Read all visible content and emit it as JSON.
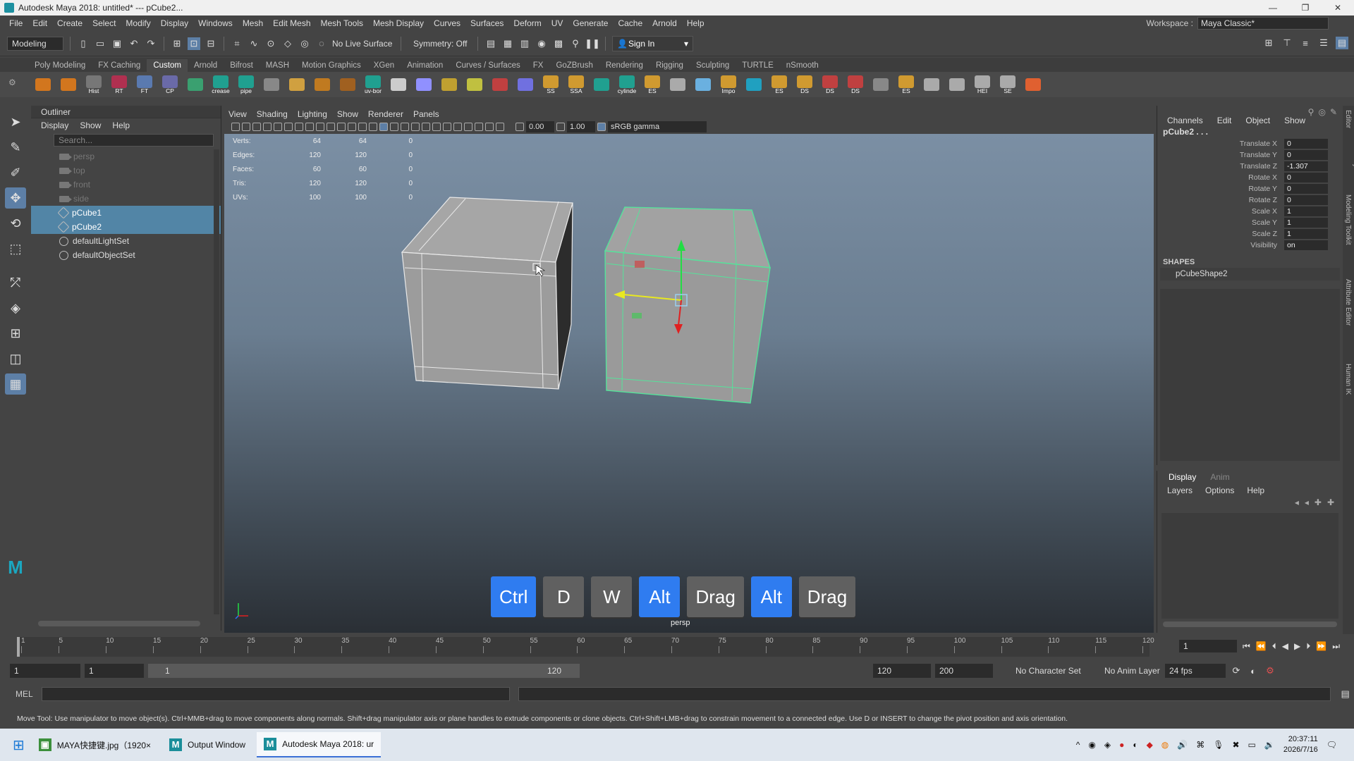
{
  "window": {
    "title": "Autodesk Maya 2018: untitled*   ---   pCube2...",
    "minimize": "—",
    "maximize": "❐",
    "close": "✕"
  },
  "menubar": {
    "items": [
      "File",
      "Edit",
      "Create",
      "Select",
      "Modify",
      "Display",
      "Windows",
      "Mesh",
      "Edit Mesh",
      "Mesh Tools",
      "Mesh Display",
      "Curves",
      "Surfaces",
      "Deform",
      "UV",
      "Generate",
      "Cache",
      "Arnold",
      "Help"
    ],
    "workspace_label": "Workspace :",
    "workspace_value": "Maya Classic*"
  },
  "statusline": {
    "mode": "Modeling",
    "live_surface": "No Live Surface",
    "symmetry": "Symmetry: Off",
    "sign_in": "Sign In"
  },
  "shelf": {
    "tabs": [
      "Poly Modeling",
      "FX Caching",
      "Custom",
      "Arnold",
      "Bifrost",
      "MASH",
      "Motion Graphics",
      "XGen",
      "Animation",
      "Curves / Surfaces",
      "FX",
      "GoZBrush",
      "Rendering",
      "Rigging",
      "Sculpting",
      "TURTLE",
      "nSmooth"
    ],
    "active_tab": "Custom",
    "buttons": [
      "",
      "",
      "Hist",
      "RT",
      "FT",
      "CP",
      "",
      "crease",
      "pipe",
      "",
      "",
      "",
      "",
      "uv-bor",
      "",
      "",
      "",
      "",
      "",
      "",
      "SS",
      "SSA",
      "",
      "cylinde",
      "ES",
      "",
      "",
      "Impo",
      "",
      "ES",
      "DS",
      "DS",
      "DS",
      "",
      "ES",
      "",
      "",
      "HEI",
      "SE",
      ""
    ]
  },
  "outliner": {
    "title": "Outliner",
    "menu": [
      "Display",
      "Show",
      "Help"
    ],
    "search_placeholder": "Search...",
    "items": [
      {
        "label": "persp",
        "dim": true,
        "icon": "camera-icon"
      },
      {
        "label": "top",
        "dim": true,
        "icon": "camera-icon"
      },
      {
        "label": "front",
        "dim": true,
        "icon": "camera-icon"
      },
      {
        "label": "side",
        "dim": true,
        "icon": "camera-icon"
      },
      {
        "label": "pCube1",
        "selected": true,
        "icon": "mesh-icon"
      },
      {
        "label": "pCube2",
        "selected": true,
        "icon": "mesh-icon"
      },
      {
        "label": "defaultLightSet",
        "icon": "set-icon"
      },
      {
        "label": "defaultObjectSet",
        "icon": "set-icon"
      }
    ]
  },
  "viewport": {
    "menu": [
      "View",
      "Shading",
      "Lighting",
      "Show",
      "Renderer",
      "Panels"
    ],
    "exposure": "0.00",
    "gamma": "1.00",
    "colorspace": "sRGB gamma",
    "camera": "persp",
    "hud": [
      {
        "k": "Verts:",
        "a": "64",
        "b": "64",
        "c": "0"
      },
      {
        "k": "Edges:",
        "a": "120",
        "b": "120",
        "c": "0"
      },
      {
        "k": "Faces:",
        "a": "60",
        "b": "60",
        "c": "0"
      },
      {
        "k": "Tris:",
        "a": "120",
        "b": "120",
        "c": "0"
      },
      {
        "k": "UVs:",
        "a": "100",
        "b": "100",
        "c": "0"
      }
    ],
    "keys": [
      {
        "label": "Ctrl",
        "blue": true
      },
      {
        "label": "D",
        "blue": false
      },
      {
        "label": "W",
        "blue": false
      },
      {
        "label": "Alt",
        "blue": true
      },
      {
        "label": "Drag",
        "blue": false
      },
      {
        "label": "Alt",
        "blue": true
      },
      {
        "label": "Drag",
        "blue": false
      }
    ]
  },
  "channelbox": {
    "menu": [
      "Channels",
      "Edit",
      "Object",
      "Show"
    ],
    "object": "pCube2 . . .",
    "channels": [
      {
        "name": "Translate X",
        "value": "0"
      },
      {
        "name": "Translate Y",
        "value": "0"
      },
      {
        "name": "Translate Z",
        "value": "-1.307"
      },
      {
        "name": "Rotate X",
        "value": "0"
      },
      {
        "name": "Rotate Y",
        "value": "0"
      },
      {
        "name": "Rotate Z",
        "value": "0"
      },
      {
        "name": "Scale X",
        "value": "1"
      },
      {
        "name": "Scale Y",
        "value": "1"
      },
      {
        "name": "Scale Z",
        "value": "1"
      },
      {
        "name": "Visibility",
        "value": "on"
      }
    ],
    "shapes_label": "SHAPES",
    "shape": "pCubeShape2"
  },
  "layers": {
    "tabs": [
      "Display",
      "Anim"
    ],
    "menu": [
      "Layers",
      "Options",
      "Help"
    ]
  },
  "rightdock": [
    "Channel Box / Layer Editor",
    "Modeling Toolkit",
    "Attribute Editor",
    "Human IK"
  ],
  "timeline": {
    "ticks": [
      "1",
      "5",
      "10",
      "15",
      "20",
      "25",
      "30",
      "35",
      "40",
      "45",
      "50",
      "55",
      "60",
      "65",
      "70",
      "75",
      "80",
      "85",
      "90",
      "95",
      "100",
      "105",
      "110",
      "115",
      "120"
    ],
    "current_frame": "1",
    "range_start": "1",
    "range_start2": "1",
    "range_bar_start": "1",
    "range_bar_end": "120",
    "range_end": "120",
    "anim_end": "200",
    "char_set": "No Character Set",
    "anim_layer": "No Anim Layer",
    "fps": "24 fps"
  },
  "cmdline": {
    "label": "MEL"
  },
  "helpline": "Move Tool: Use manipulator to move object(s). Ctrl+MMB+drag to move components along normals. Shift+drag manipulator axis or plane handles to extrude components or clone objects. Ctrl+Shift+LMB+drag to constrain movement to a connected edge. Use D or INSERT to change the pivot position and axis orientation.",
  "taskbar": {
    "apps": [
      {
        "label": "MAYA快捷键.jpg（1920×",
        "active": false
      },
      {
        "label": "Output Window",
        "active": false
      },
      {
        "label": "Autodesk Maya 2018: ur",
        "active": true
      }
    ],
    "time": "20:37:11",
    "date": "2026/7/16"
  }
}
